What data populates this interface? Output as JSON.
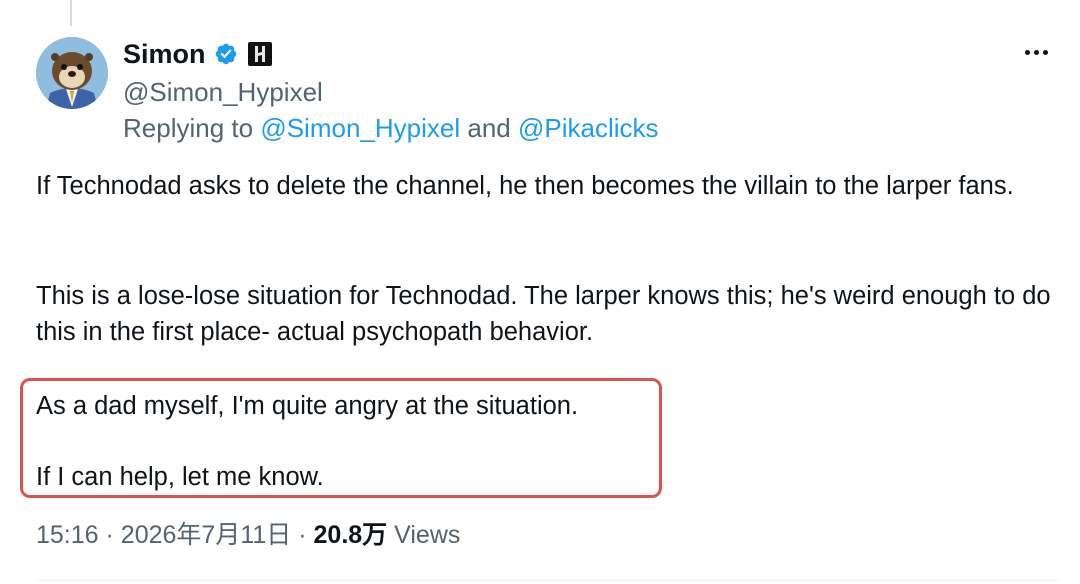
{
  "tweet": {
    "author": {
      "name": "Simon",
      "handle": "@Simon_Hypixel",
      "verified": true,
      "avatar_icon": "otter-avatar",
      "affiliate_icon": "hypixel-badge-icon"
    },
    "replying": {
      "prefix": "Replying to",
      "mention_1": "@Simon_Hypixel",
      "conjunction": "and",
      "mention_2": "@Pikaclicks"
    },
    "body": {
      "paragraph_1": "If Technodad asks to delete the channel, he then becomes the villain to the larper fans.",
      "paragraph_2": "This is a lose-lose situation for Technodad. The larper knows this; he's weird enough to do this in the first place- actual psychopath behavior.",
      "paragraph_3": "As a dad myself, I'm quite angry at the situation.",
      "paragraph_4": "If I can help, let me know."
    },
    "meta": {
      "time": "15:16",
      "separator": "·",
      "date": "2026年7月11日",
      "views_count": "20.8万",
      "views_label": "Views"
    }
  },
  "colors": {
    "text_primary": "#0f1419",
    "text_secondary": "#536471",
    "link": "#1d9bf0",
    "verified_badge": "#1d9bf0",
    "highlight_border": "#d9534f"
  },
  "icons": {
    "more": "more-options-icon",
    "verified": "verified-badge-icon"
  }
}
